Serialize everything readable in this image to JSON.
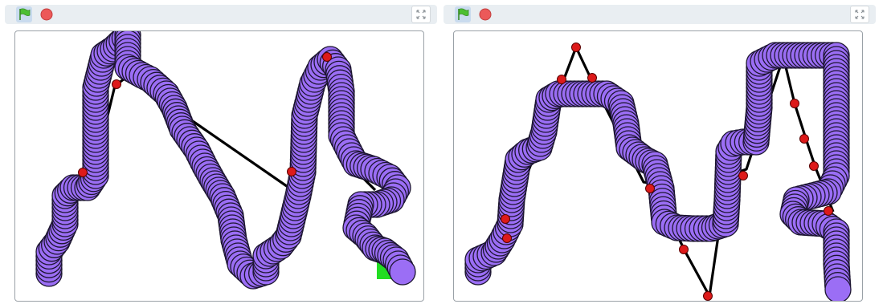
{
  "players": [
    {
      "id": "left",
      "toolbar": {
        "green_flag_icon": "green-flag-icon",
        "stop_icon": "stop-icon",
        "fullscreen_icon": "fullscreen-icon"
      },
      "pen_color": "#000000",
      "marker_color": "#dd1a1a",
      "sprite_color": "#9b6ef5",
      "goal_color": "#22dd22"
    },
    {
      "id": "right",
      "toolbar": {
        "green_flag_icon": "green-flag-icon",
        "stop_icon": "stop-icon",
        "fullscreen_icon": "fullscreen-icon"
      },
      "pen_color": "#000000",
      "marker_color": "#dd1a1a",
      "sprite_color": "#9b6ef5"
    }
  ]
}
